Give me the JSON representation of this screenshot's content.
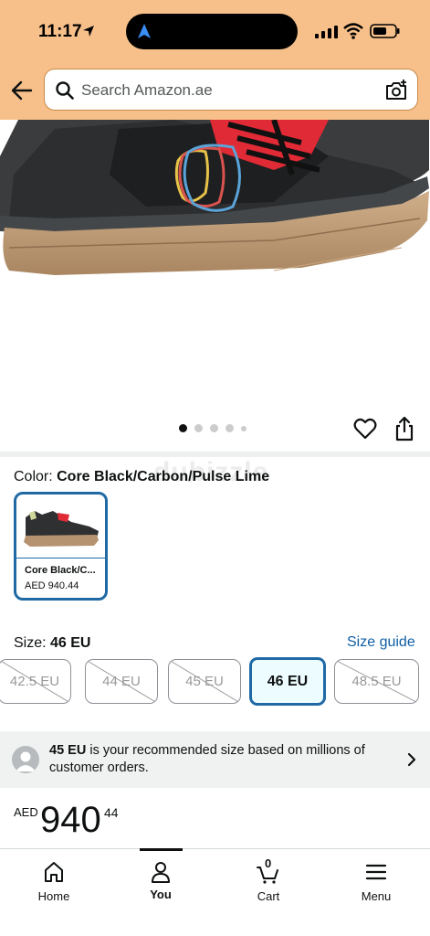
{
  "status_bar": {
    "time": "11:17"
  },
  "search": {
    "placeholder": "Search Amazon.ae"
  },
  "product": {
    "color_label": "Color: ",
    "color_value": "Core Black/Carbon/Pulse Lime",
    "swatch_name": "Core Black/C...",
    "swatch_price": "AED 940.44",
    "watermark": "dubizzle"
  },
  "size": {
    "label": "Size: ",
    "value": "46 EU",
    "guide": "Size guide",
    "options": [
      "42.5 EU",
      "44 EU",
      "45 EU",
      "46 EU",
      "48.5 EU"
    ]
  },
  "recommendation": {
    "size": "45 EU",
    "text": " is your recommended size based on millions of customer orders."
  },
  "price": {
    "currency": "AED",
    "whole": "940",
    "fraction": "44"
  },
  "nav": {
    "home": "Home",
    "you": "You",
    "cart": "Cart",
    "cart_count": "0",
    "menu": "Menu"
  },
  "colors": {
    "header": "#f7c08a",
    "accent": "#1f6aa5",
    "link": "#0f5ea5"
  }
}
